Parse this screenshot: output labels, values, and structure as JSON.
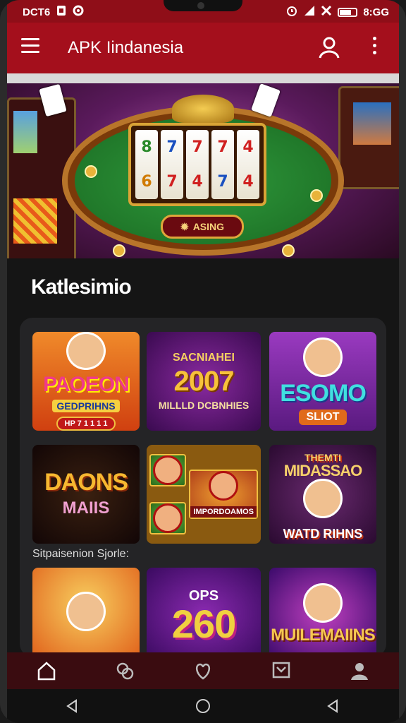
{
  "status_bar": {
    "left_text": "DCT6",
    "time": "8:GG",
    "icons": [
      "sim-icon",
      "settings-icon",
      "alarm-icon",
      "signal-icon",
      "mute-icon",
      "battery-icon"
    ],
    "battery_level": 0.7
  },
  "app_bar": {
    "title": "APK Iindanesia",
    "icons": [
      "menu-icon",
      "user-icon",
      "more-icon"
    ],
    "color": "#a40f1c"
  },
  "banner": {
    "button_label": "ASING",
    "reels": [
      [
        "8",
        "6"
      ],
      [
        "7",
        "7"
      ],
      [
        "7",
        "4"
      ],
      [
        "7",
        "7"
      ],
      [
        "4",
        "4"
      ]
    ]
  },
  "section_title": "Katlesimio",
  "games": [
    {
      "big": "PAOEON",
      "small": "GEDPRIHNS",
      "badge": "HP 7 1 1 1 1"
    },
    {
      "pre": "SACNIAHEI",
      "big": "2007",
      "small": "MILLLD DCBNHIES"
    },
    {
      "big": "ESOMO",
      "small": "SLIOT"
    },
    {
      "big": "DAONS",
      "small": "MAIIS"
    },
    {
      "label": "IMPORDOAMOS"
    },
    {
      "pre": "THEMTI",
      "big": "MIDASSAO",
      "small": "WATD RIHNS"
    }
  ],
  "sub_section_title": "Sitpaisenion Sjorle:",
  "games_row3": [
    {
      "big": ""
    },
    {
      "big": "260",
      "small": "OPS"
    },
    {
      "big": "MUILEMAIINS"
    }
  ],
  "bottom_nav": [
    "home-icon",
    "games-icon",
    "favorites-icon",
    "inbox-icon",
    "profile-icon"
  ],
  "system_nav": [
    "back-icon",
    "home-circle-icon",
    "recents-icon"
  ]
}
